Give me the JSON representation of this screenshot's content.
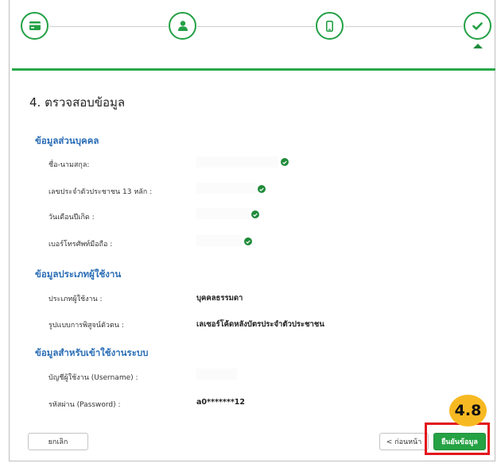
{
  "section_title": "4. ตรวจสอบข้อมูล",
  "personal": {
    "title": "ข้อมูลส่วนบุคคล",
    "rows": [
      {
        "label": "ชื่อ-นามสกุล:"
      },
      {
        "label": "เลขประจำตัวประชาชน 13 หลัก :"
      },
      {
        "label": "วันเดือนปีเกิด :"
      },
      {
        "label": "เบอร์โทรศัพท์มือถือ :"
      }
    ]
  },
  "user_type": {
    "title": "ข้อมูลประเภทผู้ใช้งาน",
    "rows": [
      {
        "label": "ประเภทผู้ใช้งาน :",
        "value": "บุคคลธรรมดา"
      },
      {
        "label": "รูปแบบการพิสูจน์ตัวตน :",
        "value": "เลเซอร์โค้ดหลังบัตรประจำตัวประชาชน"
      }
    ]
  },
  "login": {
    "title": "ข้อมูลสำหรับเข้าใช้งานระบบ",
    "rows": [
      {
        "label": "บัญชีผู้ใช้งาน (Username) :",
        "value": ""
      },
      {
        "label": "รหัสผ่าน (Password) :",
        "value": "a0*******12"
      }
    ]
  },
  "buttons": {
    "cancel": "ยกเลิก",
    "back": "< ก่อนหน้า",
    "confirm": "ยืนยันข้อมูล"
  },
  "annotation": {
    "badge": "4.8"
  },
  "colors": {
    "accent": "#25a244",
    "link": "#2a6db5",
    "highlight": "#e3141c",
    "badge": "#f7b922"
  },
  "steps": [
    {
      "icon": "credit-card-icon",
      "done": true
    },
    {
      "icon": "user-icon",
      "done": true
    },
    {
      "icon": "mobile-phone-icon",
      "done": true
    },
    {
      "icon": "check-icon",
      "done": true,
      "current": true
    }
  ]
}
